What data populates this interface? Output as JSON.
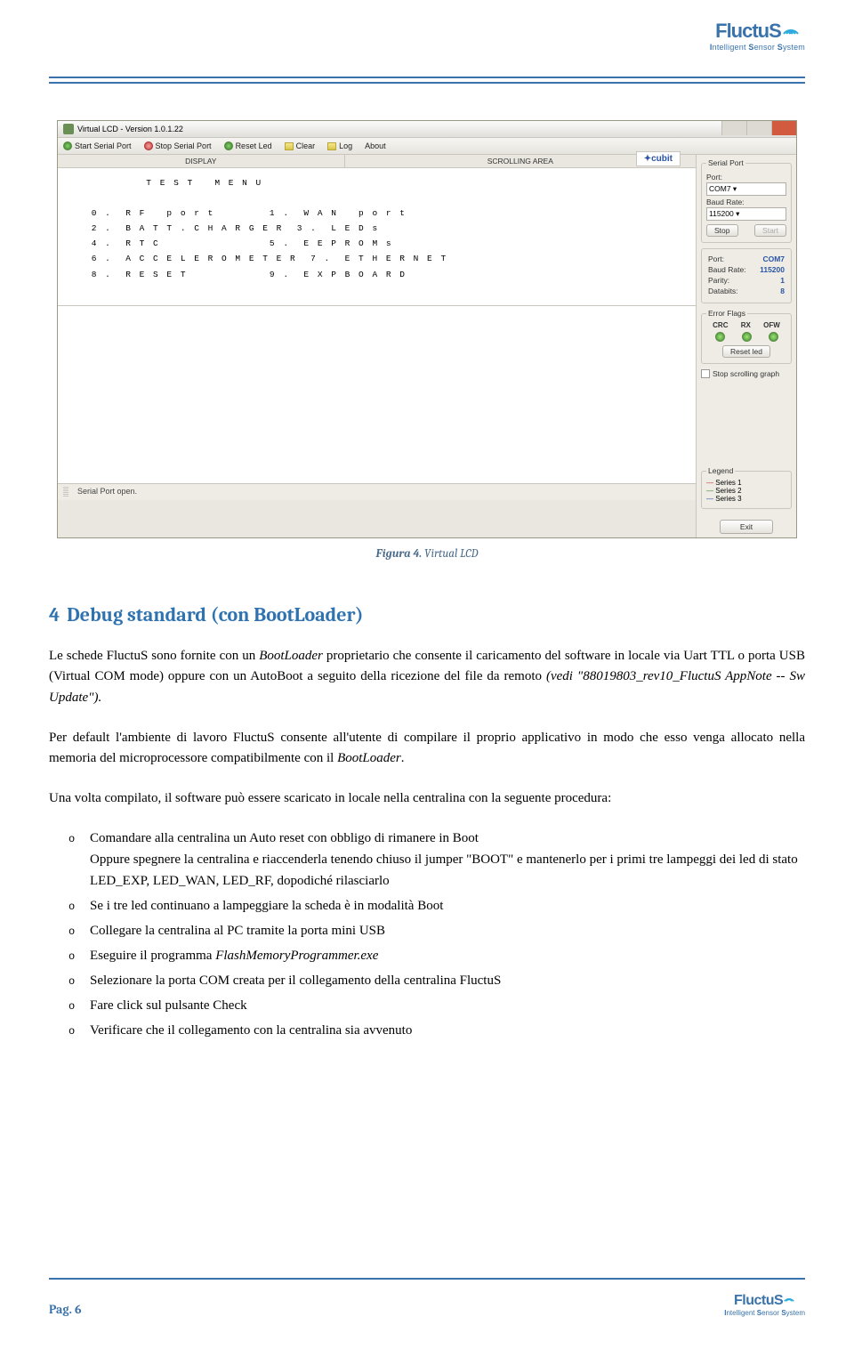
{
  "header": {
    "brand": "FluctuS",
    "tagline_html": "Intelligent Sensor System"
  },
  "screenshot": {
    "window_title": "Virtual LCD - Version 1.0.1.22",
    "toolbar": {
      "start": "Start Serial Port",
      "stop": "Stop Serial Port",
      "reset_led": "Reset Led",
      "clear": "Clear",
      "log": "Log",
      "about": "About"
    },
    "col_headers": {
      "display": "DISPLAY",
      "scrolling": "SCROLLING AREA"
    },
    "cubit_label": "cubit",
    "lcd_lines": [
      "         T E S T   M E N U",
      "",
      " 0 .  R F   p o r t        1 .  W A N   p o r t",
      " 2 .  B A T T . C H A R G E R  3 .  L E D s",
      " 4 .  R T C                5 .  E E P R O M s",
      " 6 .  A C C E L E R O M E T E R  7 .  E T H E R N E T",
      " 8 .  R E S E T            9 .  E X P B O A R D"
    ],
    "right": {
      "serial_port_legend": "Serial Port",
      "port_label": "Port:",
      "port_value": "COM7",
      "baud_label": "Baud Rate:",
      "baud_value": "115200",
      "stop_btn": "Stop",
      "start_btn": "Start",
      "status": {
        "port": {
          "label": "Port:",
          "value": "COM7"
        },
        "baud": {
          "label": "Baud Rate:",
          "value": "115200"
        },
        "parity": {
          "label": "Parity:",
          "value": "1"
        },
        "databits": {
          "label": "Databits:",
          "value": "8"
        }
      },
      "error_flags_legend": "Error Flags",
      "flag_crc": "CRC",
      "flag_rx": "RX",
      "flag_ofw": "OFW",
      "reset_led_btn": "Reset led",
      "stop_scroll": "Stop scrolling graph",
      "legend_legend": "Legend",
      "series1": "Series 1",
      "series2": "Series 2",
      "series3": "Series 3",
      "exit_btn": "Exit"
    },
    "status_bar": "Serial Port open."
  },
  "caption": {
    "prefix": "Figura 4.",
    "text": " Virtual LCD"
  },
  "heading": {
    "num": "4",
    "title": "Debug standard (con BootLoader)"
  },
  "p1_a": "Le schede FluctuS sono fornite con un ",
  "p1_b": "BootLoader",
  "p1_c": " proprietario che consente il caricamento del software in locale via Uart TTL o porta USB (Virtual COM mode) oppure con un AutoBoot a seguito della ricezione del file da remoto ",
  "p1_d": "(vedi \"88019803_rev10_FluctuS AppNote -- Sw Update\").",
  "p2_a": "Per default l'ambiente di lavoro FluctuS consente all'utente di compilare il proprio applicativo in modo che esso venga allocato nella memoria del microprocessore compatibilmente con il ",
  "p2_b": "BootLoader",
  "p2_c": ".",
  "p3": "Una volta compilato, il software può essere scaricato in locale nella centralina con la seguente procedura:",
  "steps": [
    "Comandare alla centralina un Auto reset con obbligo di rimanere in Boot\nOppure spegnere la centralina e riaccenderla tenendo chiuso il jumper \"BOOT\" e mantenerlo per i primi tre lampeggi dei led di stato LED_EXP, LED_WAN, LED_RF, dopodiché rilasciarlo",
    "Se i tre led continuano a lampeggiare la scheda è in modalità Boot",
    "Collegare la centralina al PC tramite la porta mini USB",
    "Eseguire il programma __ITALIC__FlashMemoryProgrammer.exe__END__",
    "Selezionare la porta COM creata per il collegamento della centralina FluctuS",
    "Fare click sul pulsante Check",
    "Verificare che il collegamento con la centralina sia avvenuto"
  ],
  "footer": {
    "page": "Pag. 6"
  }
}
